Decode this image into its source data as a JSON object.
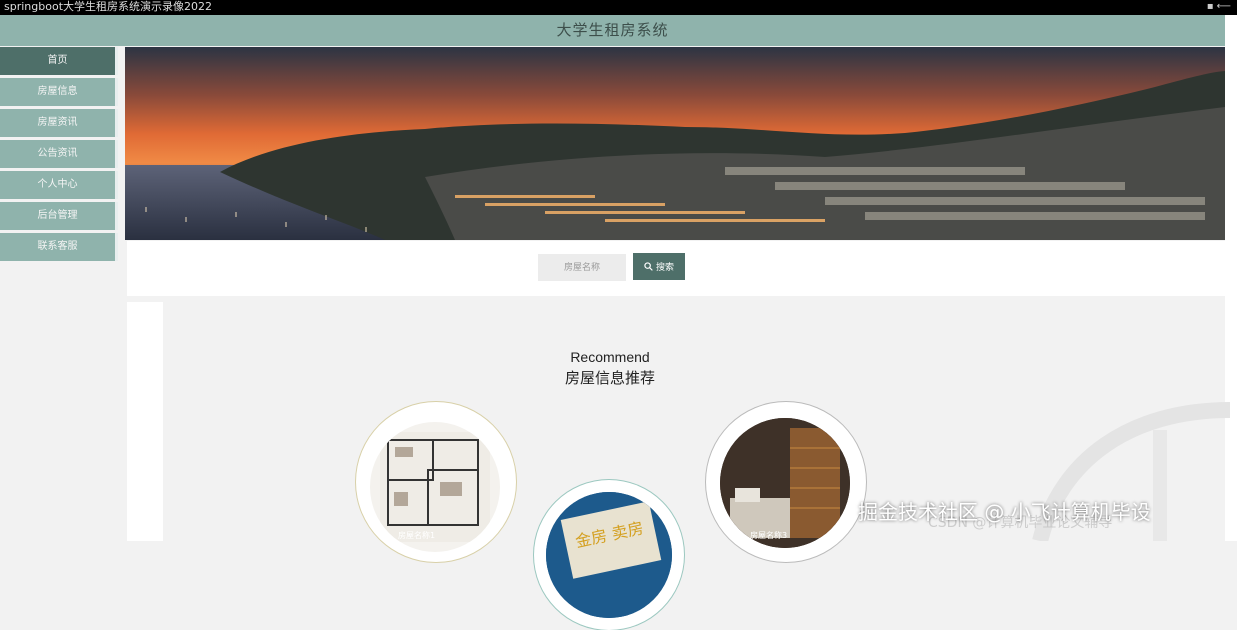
{
  "window": {
    "title": "springboot大学生租房系统演示录像2022",
    "controls": "▪ ⟵"
  },
  "header": {
    "title": "大学生租房系统"
  },
  "sidebar": {
    "items": [
      {
        "label": "首页",
        "active": true
      },
      {
        "label": "房屋信息"
      },
      {
        "label": "房屋资讯"
      },
      {
        "label": "公告资讯"
      },
      {
        "label": "个人中心"
      },
      {
        "label": "后台管理"
      },
      {
        "label": "联系客服"
      }
    ]
  },
  "search": {
    "placeholder": "房屋名称",
    "button_label": "搜索"
  },
  "recommend": {
    "title_en": "Recommend",
    "title_cn": "房屋信息推荐",
    "cards": [
      {
        "label": "房屋名称1"
      },
      {
        "label": ""
      },
      {
        "label": "房屋名称3"
      }
    ]
  },
  "watermark": {
    "primary": "掘金技术社区 @ 小飞计算机毕设",
    "secondary": "CSDN @计算机毕业论文辅导"
  },
  "colors": {
    "accent": "#8fb3ac",
    "accent_dark": "#4e6f69",
    "background": "#f2f2f2"
  }
}
